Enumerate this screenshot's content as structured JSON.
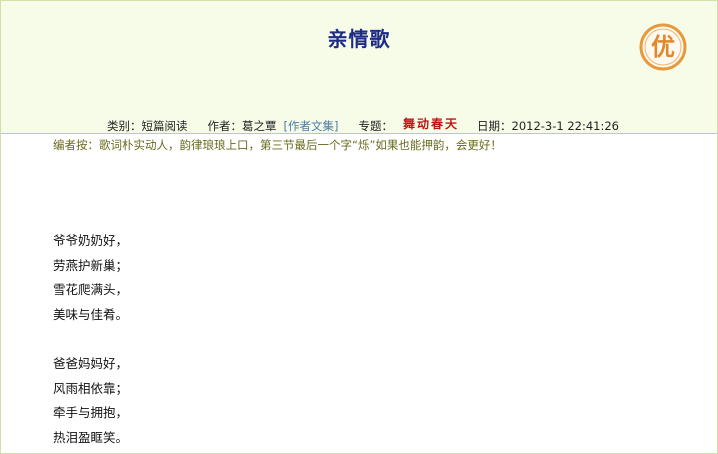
{
  "article": {
    "title": "亲情歌",
    "badge_text": "优",
    "meta": {
      "category_label": "类别：",
      "category_value": "短篇阅读",
      "author_label": "作者：",
      "author_value": "葛之覃",
      "author_works_link": "[作者文集]",
      "topic_label": "专题：",
      "topic_value": "舞动春天",
      "date_label": "日期：",
      "date_value": "2012-3-1 22:41:26"
    },
    "editor_note": "编者按：歌词朴实动人，韵律琅琅上口，第三节最后一个字“烁”如果也能押韵，会更好！"
  },
  "poem": {
    "stanza1": [
      "爷爷奶奶好，",
      "劳燕护新巢；",
      "雪花爬满头，",
      "美味与佳肴。"
    ],
    "stanza2": [
      "爸爸妈妈好，",
      "风雨相依靠；",
      "牵手与拥抱，",
      "热泪盈眶笑。"
    ]
  },
  "colors": {
    "header_bg": "#f7fce8",
    "title": "#1d2a86",
    "badge": "#e0892a",
    "topic": "#c01414",
    "editor_note": "#6a6b1f",
    "link": "#4d7ba8"
  }
}
